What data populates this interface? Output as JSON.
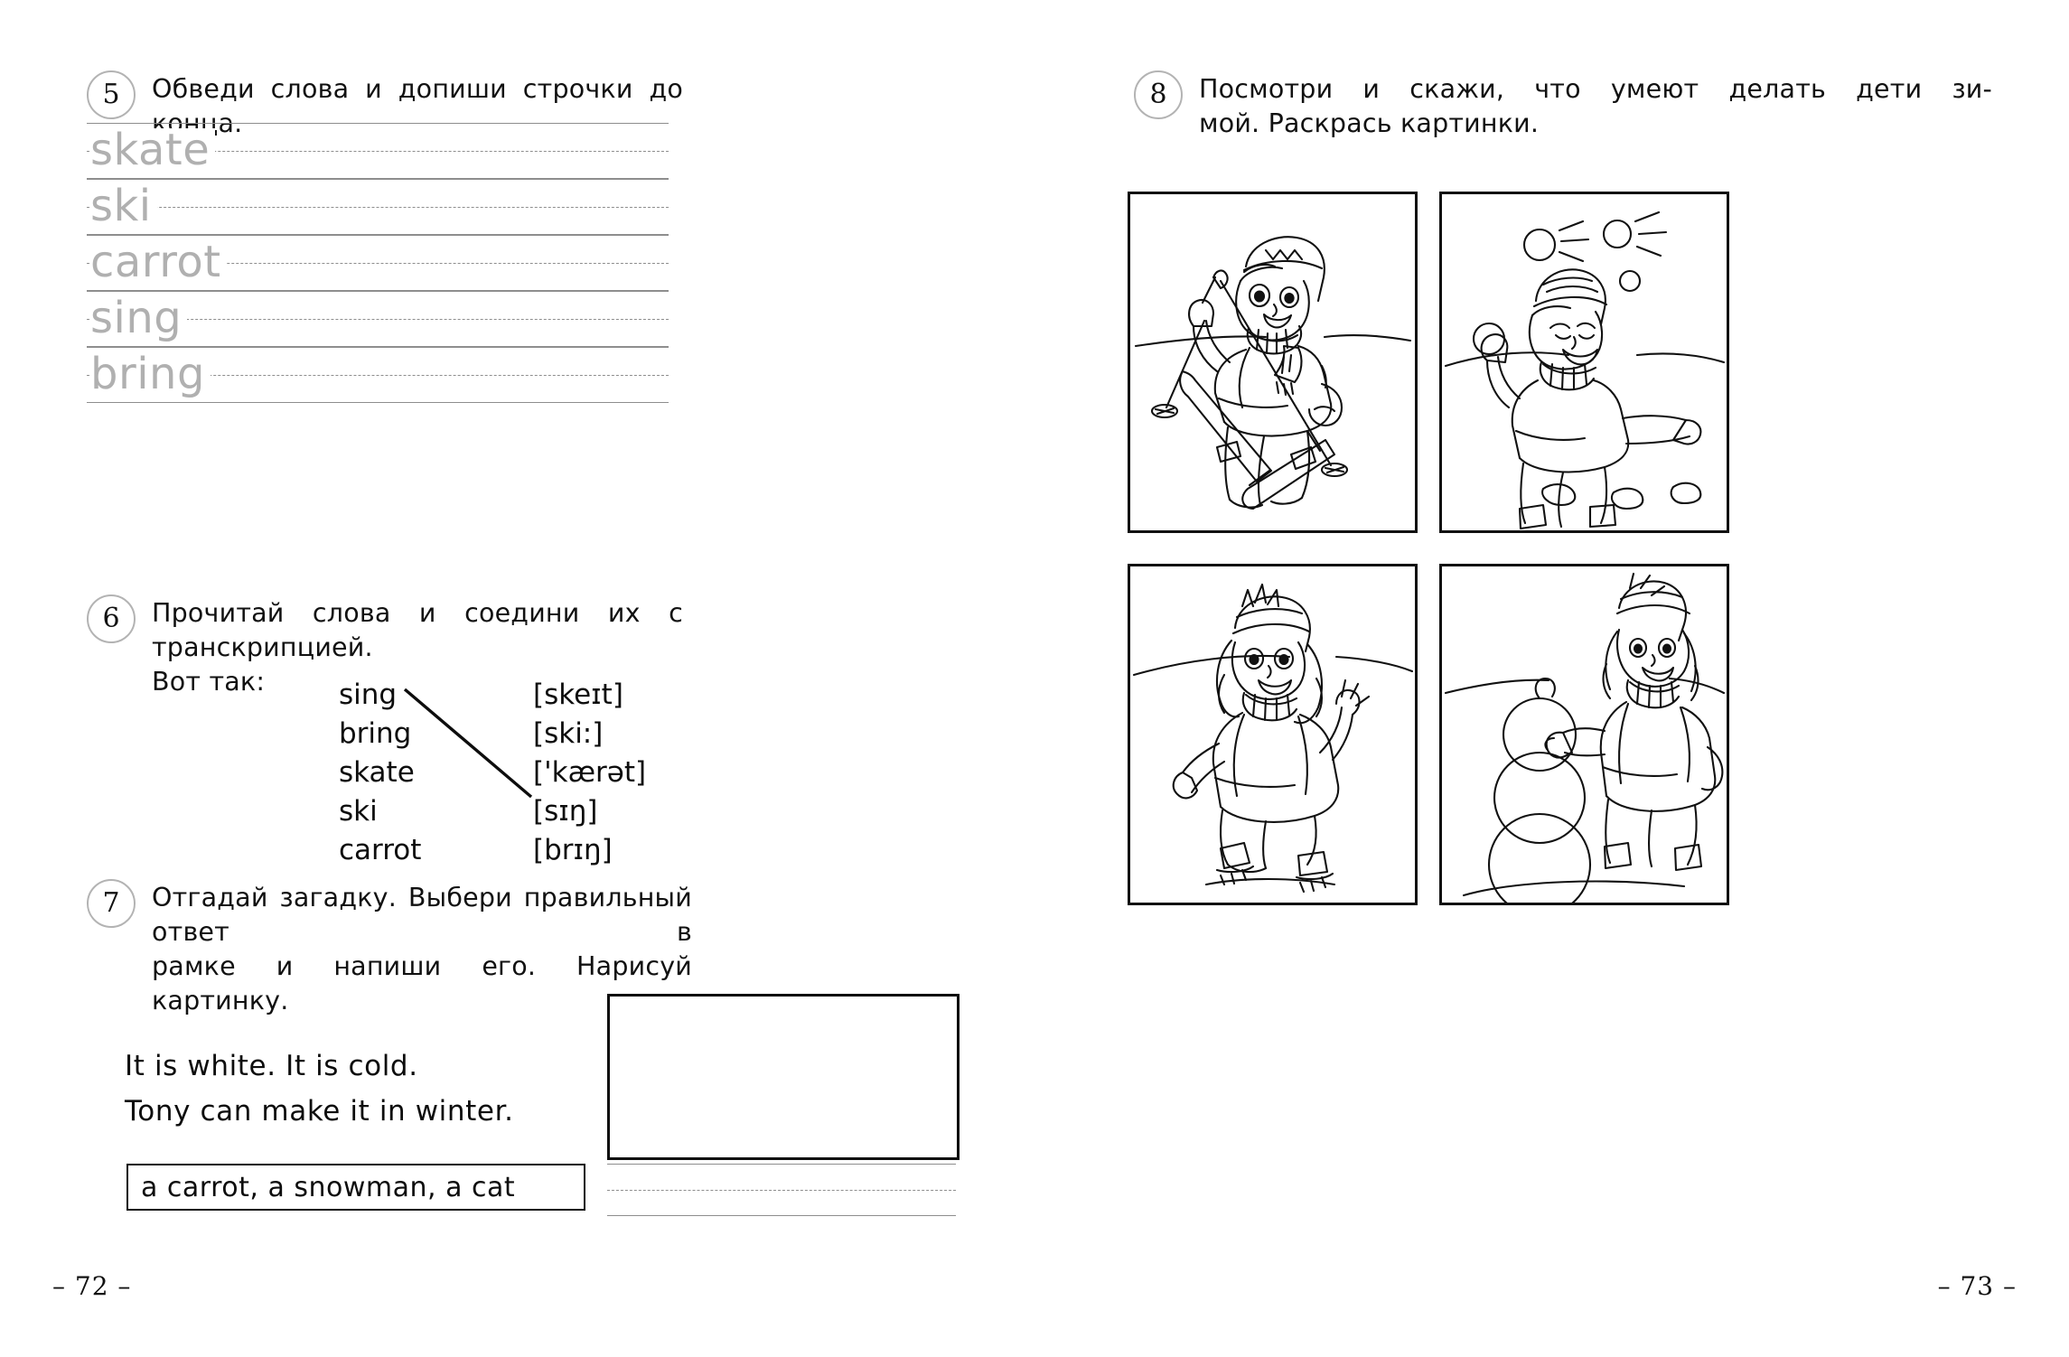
{
  "spread": {
    "left_page_number": "– 72 –",
    "right_page_number": "– 73 –"
  },
  "exercise5": {
    "number": "5",
    "instruction": "Обведи слова и допиши строчки до конца.",
    "trace_words": [
      "skate",
      "ski",
      "carrot",
      "sing",
      "bring"
    ]
  },
  "exercise6": {
    "number": "6",
    "instruction_line1": "Прочитай слова и соедини их с транскрипцией.",
    "instruction_line2": "Вот так:",
    "words": [
      "sing",
      "bring",
      "skate",
      "ski",
      "carrot"
    ],
    "transcriptions": [
      "[skeɪt]",
      "[ski:]",
      "['kærət]",
      "[sɪŋ]",
      "[brɪŋ]"
    ],
    "connection": {
      "from_word": "sing",
      "to_transcription": "[sɪŋ]"
    }
  },
  "exercise7": {
    "number": "7",
    "instruction_line1": "Отгадай загадку. Выбери правильный ответ в",
    "instruction_line2": "рамке и напиши его. Нарисуй картинку.",
    "riddle_line1": "It is white. It is cold.",
    "riddle_line2": "Tony can make it in winter.",
    "choices": "a carrot, a snowman, a cat",
    "drawing_box_label": "",
    "answer_writing_line": ""
  },
  "exercise8": {
    "number": "8",
    "instruction_line1": "Посмотри и скажи, что умеют делать дети зи-",
    "instruction_line2": "мой. Раскрась картинки.",
    "pictures": [
      {
        "id": "picture-skiing-boy",
        "caption": "boy skiing"
      },
      {
        "id": "picture-snowball-boy",
        "caption": "boy throwing snowballs"
      },
      {
        "id": "picture-skating-girl",
        "caption": "girl skating"
      },
      {
        "id": "picture-snowman-girl",
        "caption": "girl making a snowman"
      }
    ]
  },
  "colors": {
    "ink": "#0d0d0d",
    "rule_line": "#8e8e8e",
    "trace_word": "#b0b0b0",
    "circle_border": "#b3b3b3"
  }
}
